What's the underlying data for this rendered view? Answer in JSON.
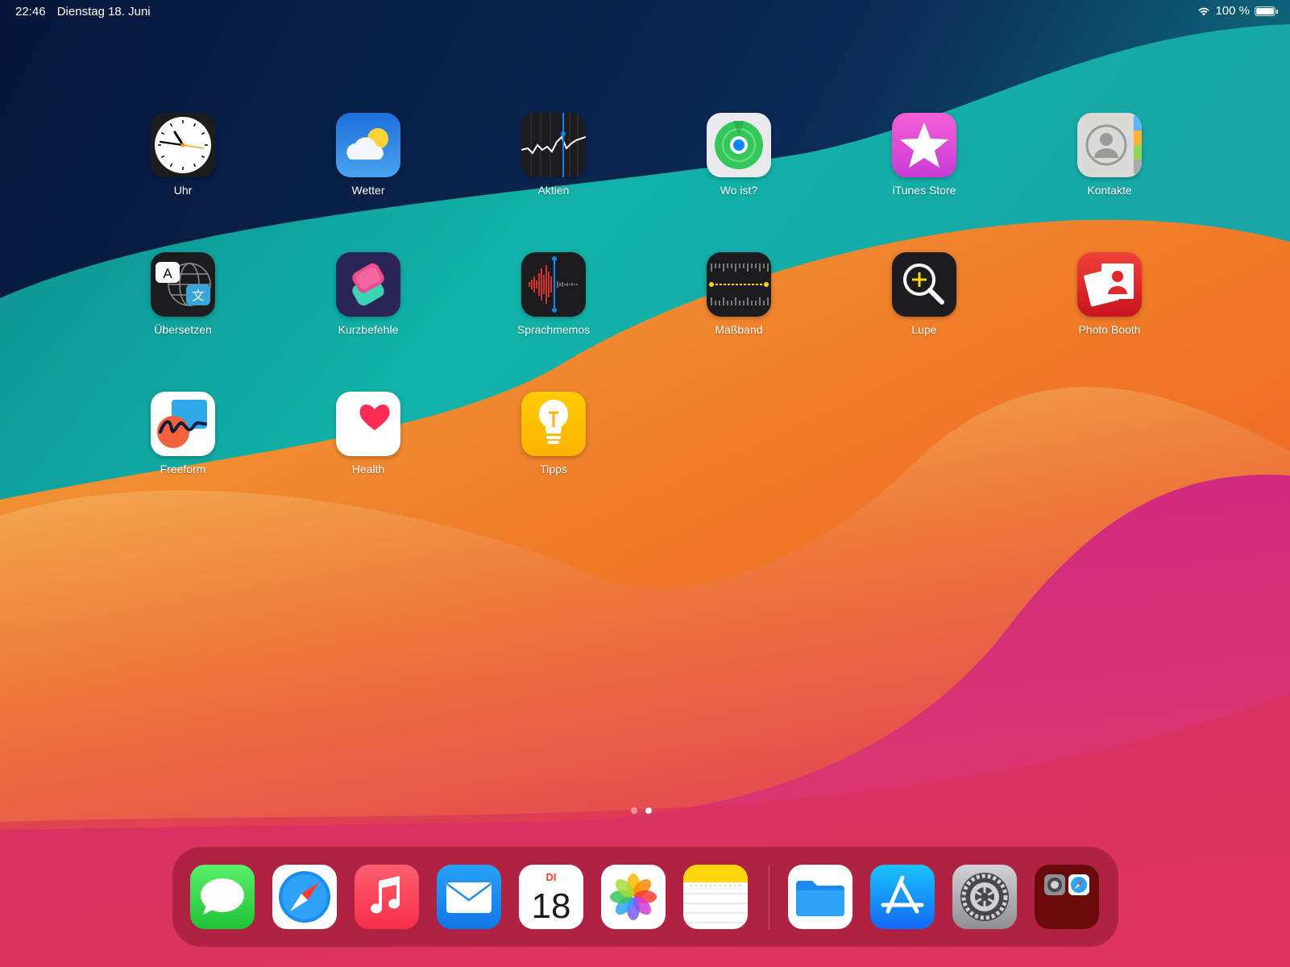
{
  "status_bar": {
    "time": "22:46",
    "date": "Dienstag 18. Juni",
    "battery": "100 %",
    "wifi_icon": "wifi-icon",
    "battery_icon": "battery-icon"
  },
  "home_apps": [
    {
      "label": "Uhr",
      "icon": "clock-icon"
    },
    {
      "label": "Wetter",
      "icon": "weather-icon"
    },
    {
      "label": "Aktien",
      "icon": "stocks-icon"
    },
    {
      "label": "Wo ist?",
      "icon": "find-my-icon"
    },
    {
      "label": "iTunes Store",
      "icon": "itunes-store-icon"
    },
    {
      "label": "Kontakte",
      "icon": "contacts-icon"
    },
    {
      "label": "Übersetzen",
      "icon": "translate-icon"
    },
    {
      "label": "Kurzbefehle",
      "icon": "shortcuts-icon"
    },
    {
      "label": "Sprachmemos",
      "icon": "voice-memos-icon"
    },
    {
      "label": "Maßband",
      "icon": "measure-icon"
    },
    {
      "label": "Lupe",
      "icon": "magnifier-icon"
    },
    {
      "label": "Photo Booth",
      "icon": "photo-booth-icon"
    },
    {
      "label": "Freeform",
      "icon": "freeform-icon"
    },
    {
      "label": "Health",
      "icon": "health-icon"
    },
    {
      "label": "Tipps",
      "icon": "tips-icon"
    }
  ],
  "page_dots": {
    "count": 2,
    "active": 1
  },
  "dock": {
    "apps": [
      {
        "icon": "messages-icon"
      },
      {
        "icon": "safari-icon"
      },
      {
        "icon": "music-icon"
      },
      {
        "icon": "mail-icon"
      },
      {
        "icon": "calendar-icon",
        "weekday": "DI",
        "day": "18"
      },
      {
        "icon": "photos-icon"
      },
      {
        "icon": "notes-icon"
      }
    ],
    "recent_apps": [
      {
        "icon": "files-icon"
      },
      {
        "icon": "app-store-icon"
      },
      {
        "icon": "settings-icon"
      },
      {
        "icon": "app-library-folder-icon"
      }
    ]
  }
}
